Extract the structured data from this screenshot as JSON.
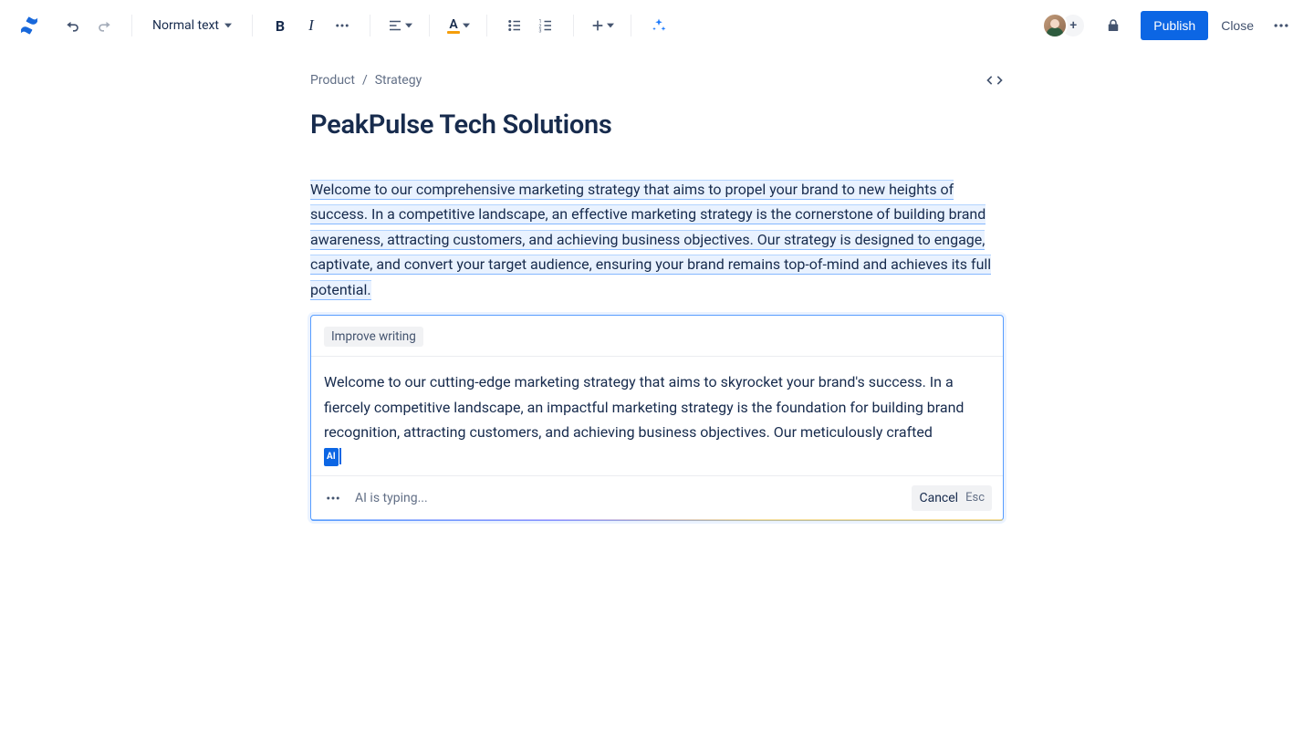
{
  "toolbar": {
    "text_style": "Normal text",
    "publish_label": "Publish",
    "close_label": "Close",
    "avatar_add": "+"
  },
  "breadcrumb": {
    "item1": "Product",
    "sep": "/",
    "item2": "Strategy"
  },
  "page": {
    "title": "PeakPulse Tech Solutions",
    "paragraph": "Welcome to our comprehensive marketing strategy that aims to propel your brand to new heights of success. In a competitive landscape, an effective marketing strategy is the cornerstone of building brand awareness, attracting customers, and achieving business objectives. Our strategy is designed to engage, captivate, and convert your target audience, ensuring your brand remains top-of-mind and achieves its full potential."
  },
  "ai": {
    "chip": "Improve writing",
    "suggestion": "Welcome to our cutting-edge marketing strategy that aims to skyrocket your brand's success. In a fiercely competitive landscape, an impactful marketing strategy is the foundation for building brand recognition, attracting customers, and achieving business objectives. Our meticulously crafted",
    "badge": "AI",
    "status": "AI is typing...",
    "cancel": "Cancel",
    "esc": "Esc"
  }
}
